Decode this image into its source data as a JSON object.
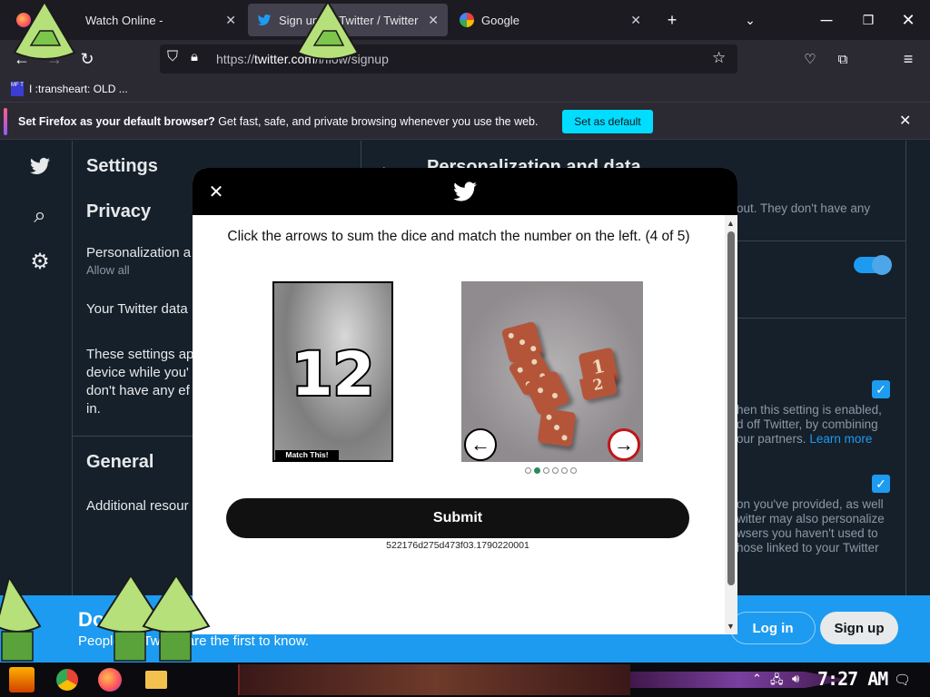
{
  "browser": {
    "tabs": [
      {
        "title": "Watch Online -",
        "favicon": "firefox-icon"
      },
      {
        "title": "Sign up for Twitter / Twitter",
        "favicon": "twitter-icon"
      },
      {
        "title": "Google",
        "favicon": "google-icon"
      }
    ],
    "url_prefix": "https://",
    "url_host": "twitter.com",
    "url_path": "/i/flow/signup",
    "bookmark": "I :transheart: OLD ...",
    "bookmark_badge": "MF T",
    "notification": {
      "bold": "Set Firefox as your default browser?",
      "text": " Get fast, safe, and private browsing whenever you use the web.",
      "button": "Set as default"
    }
  },
  "twitter": {
    "settings_title": "Settings",
    "privacy_heading": "Privacy",
    "personalization_label": "Personalization a",
    "personalization_sub": "Allow all",
    "your_data": "Your Twitter data",
    "settings_para": [
      "These settings ap",
      "device while you'",
      "don't have any ef",
      "in."
    ],
    "general_heading": "General",
    "additional": "Additional resour",
    "detail_title": "Personalization and data",
    "detail_text_1": "out. They don't have any",
    "detail_text_2": [
      "hen this setting is enabled,",
      "d off Twitter, by combining",
      "our partners."
    ],
    "learn_more": "Learn more",
    "detail_text_3": [
      "on you've provided, as well",
      "witter may also personalize",
      "wsers you haven't used to",
      "hose linked to your Twitter"
    ],
    "banner_title": "Do",
    "banner_sub": "People on Twitter are the first to know.",
    "login": "Log in",
    "signup": "Sign up",
    "accent_color": "#1d9bf0"
  },
  "captcha": {
    "instruction": "Click the arrows to sum the dice and match the number on the left. (4 of 5)",
    "target_number": "12",
    "target_tag": "Match This!",
    "dice_faces": [
      3,
      4,
      1,
      2,
      3,
      2
    ],
    "dice_digit_face": "1",
    "dice_digit_face_2": "2",
    "dots_total": 6,
    "dots_active": 2,
    "submit": "Submit",
    "session_id": "522176d275d473f03.1790220001"
  },
  "taskbar": {
    "clock": "7:27 AM"
  }
}
